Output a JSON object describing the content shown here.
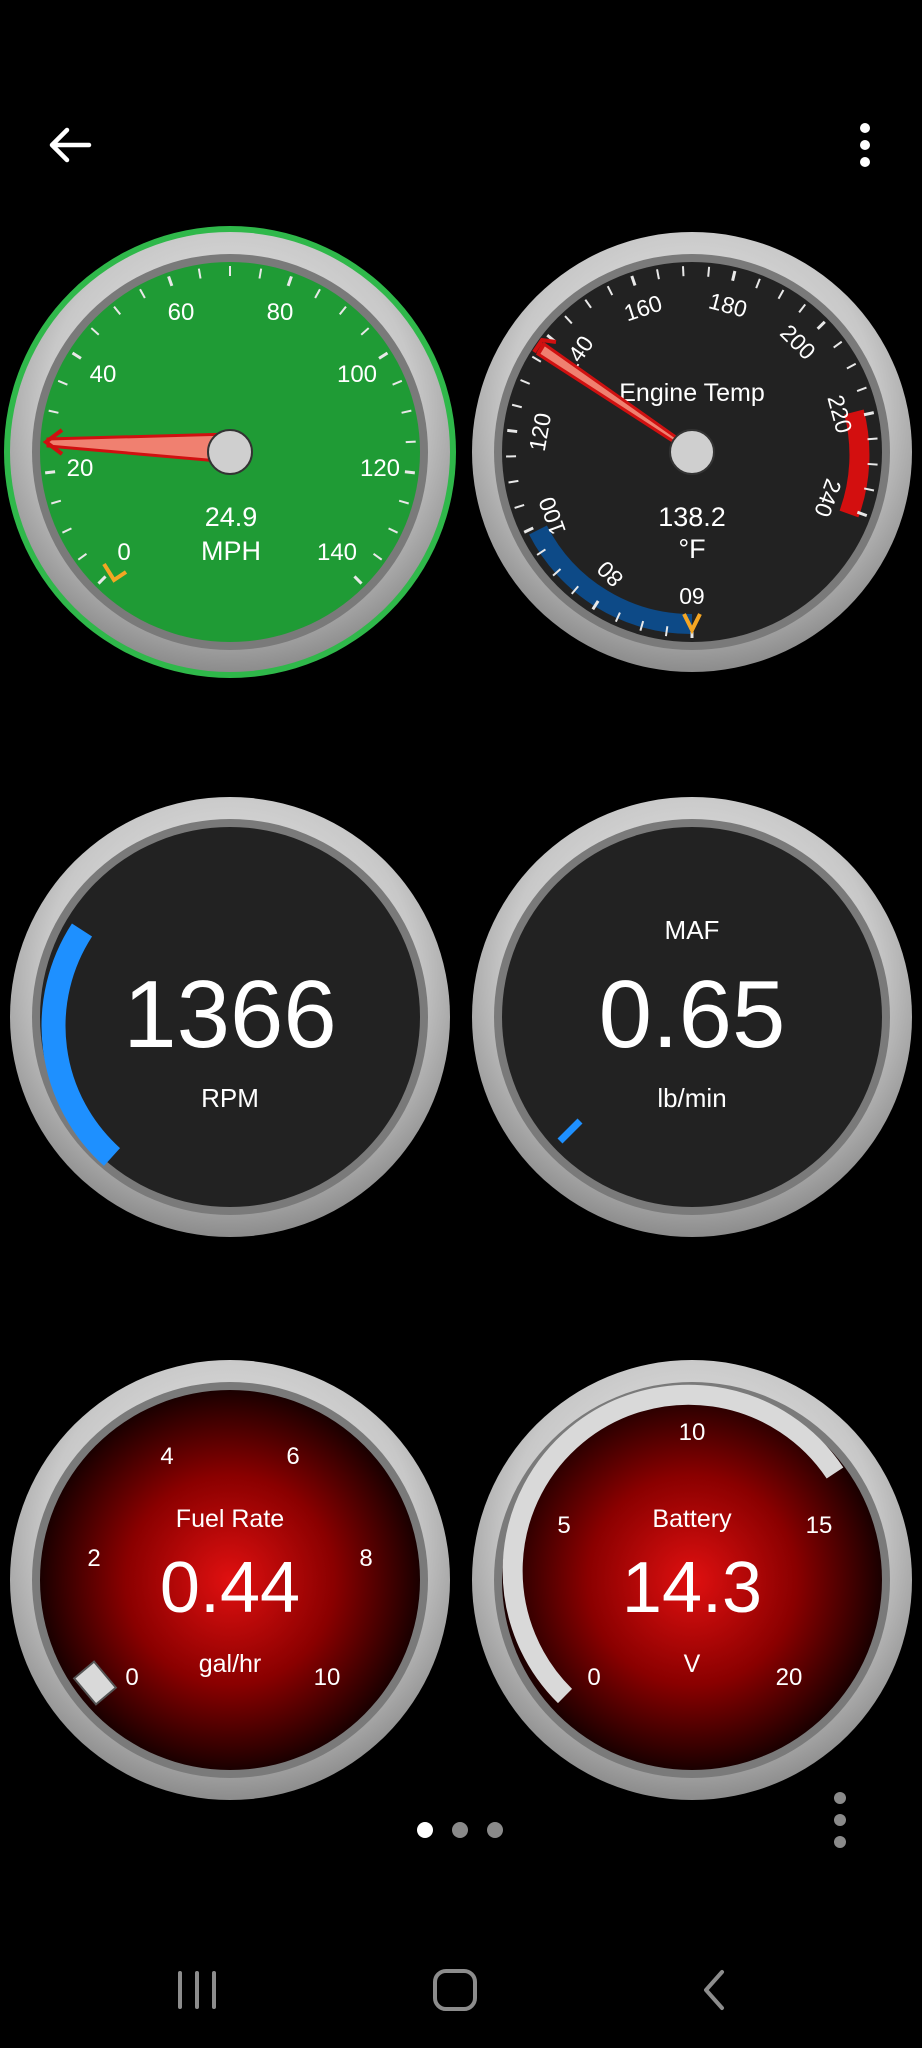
{
  "topbar": {
    "back_icon": "back-arrow-icon",
    "menu_icon": "more-vertical-icon"
  },
  "colors": {
    "green": "#1f9b35",
    "dark": "#222222",
    "red": "#b30000",
    "needle": "#e2261a",
    "blue": "#1e90ff",
    "orange": "#f5a623"
  },
  "gauges": {
    "speed": {
      "value": "24.9",
      "unit": "MPH",
      "ticks": [
        "0",
        "20",
        "40",
        "60",
        "80",
        "100",
        "120",
        "140"
      ],
      "reading": 24.9,
      "min": 0,
      "max": 140
    },
    "temp": {
      "title": "Engine Temp",
      "value": "138.2",
      "unit": "°F",
      "ticks": [
        "60",
        "80",
        "100",
        "120",
        "140",
        "160",
        "180",
        "200",
        "220",
        "240"
      ],
      "reading": 138.2,
      "min": 60,
      "max": 240
    },
    "rpm": {
      "value": "1366",
      "unit": "RPM"
    },
    "maf": {
      "title": "MAF",
      "value": "0.65",
      "unit": "lb/min"
    },
    "fuel": {
      "title": "Fuel Rate",
      "value": "0.44",
      "unit": "gal/hr",
      "ticks": [
        "0",
        "2",
        "4",
        "6",
        "8",
        "10"
      ]
    },
    "battery": {
      "title": "Battery",
      "value": "14.3",
      "unit": "V",
      "ticks": [
        "0",
        "5",
        "10",
        "15",
        "20"
      ],
      "reading": 14.3,
      "min": 0,
      "max": 20
    }
  },
  "pager": {
    "count": 3,
    "active": 0,
    "more_icon": "more-vertical-icon"
  },
  "navbar": {
    "recents_icon": "recents-icon",
    "home_icon": "home-icon",
    "back_icon": "nav-back-icon"
  }
}
